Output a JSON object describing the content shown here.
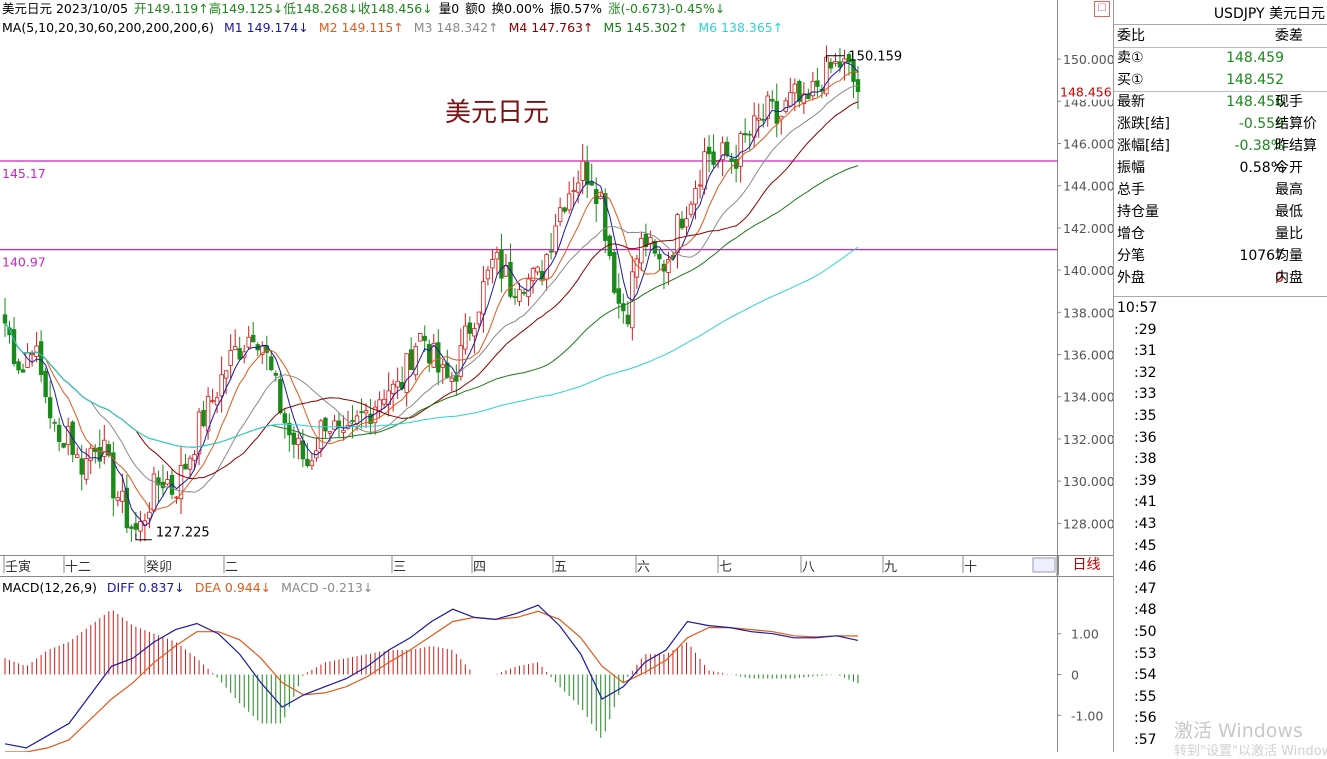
{
  "header": {
    "title_line": "美元日元 2023/10/05",
    "open": "开149.119↑",
    "high": "高149.125↓",
    "low": "低148.268↓",
    "close": "收148.456↓",
    "volume": "量0",
    "amount": "额0",
    "turnover": "换0.00%",
    "amplitude": "振0.57%",
    "change": "涨(-0.673)-0.45%↓"
  },
  "ma_line": {
    "label": "MA(5,10,20,30,60,200,200,200,6)",
    "items": [
      {
        "text": "M1 149.174↓",
        "color": "#1a1aa0"
      },
      {
        "text": "M2 149.115↑",
        "color": "#e05a1a"
      },
      {
        "text": "M3 148.342↑",
        "color": "#8a8a8a"
      },
      {
        "text": "M4 147.763↑",
        "color": "#8b0000"
      },
      {
        "text": "M5 145.302↑",
        "color": "#1a7a1a"
      },
      {
        "text": "M6 138.365↑",
        "color": "#2ad4d4"
      }
    ]
  },
  "chart_label": "美元日元",
  "hlines": [
    {
      "label": "145.17",
      "value": 145.17
    },
    {
      "label": "140.97",
      "value": 140.97
    }
  ],
  "annotations": {
    "max": "150.159",
    "min": "127.225",
    "last_price": "148.456"
  },
  "months": [
    "壬寅",
    "十二",
    "癸卯",
    "二",
    "三",
    "四",
    "五",
    "六",
    "七",
    "八",
    "九",
    "十"
  ],
  "timeframe_button": "日线",
  "macd_header": {
    "label": "MACD(12,26,9)",
    "diff": "DIFF 0.837↓",
    "dea": "DEA 0.944↓",
    "macd": "MACD -0.213↓"
  },
  "sidebar": {
    "symbol": "USDJPY 美元日元",
    "rows": [
      {
        "l": "委比",
        "v": "",
        "r": "委差"
      },
      {
        "l": "卖①",
        "v": "148.459",
        "r": ""
      },
      {
        "l": "买①",
        "v": "148.452",
        "r": ""
      },
      {
        "l": "最新",
        "v": "148.456",
        "r": "现手"
      },
      {
        "l": "涨跌[结]",
        "v": "-0.559",
        "r": "结算价"
      },
      {
        "l": "涨幅[结]",
        "v": "-0.38%",
        "r": "昨结算"
      },
      {
        "l": "振幅",
        "v": "0.58%",
        "r": "今开"
      },
      {
        "l": "总手",
        "v": "",
        "r": "最高"
      },
      {
        "l": "持仓量",
        "v": "",
        "r": "最低"
      },
      {
        "l": "增仓",
        "v": "",
        "r": "量比"
      },
      {
        "l": "分笔",
        "v": "10767",
        "r": "均量"
      },
      {
        "l": "外盘",
        "v": "0",
        "r": "内盘"
      }
    ],
    "times": [
      "10:57",
      ":29",
      ":31",
      ":32",
      ":33",
      ":35",
      ":36",
      ":38",
      ":39",
      ":41",
      ":43",
      ":45",
      ":46",
      ":47",
      ":48",
      ":50",
      ":53",
      ":54",
      ":55",
      ":56",
      ":57"
    ]
  },
  "watermark": {
    "line1": "激活 Windows",
    "line2": "转到\"设置\"以激活 Windows。"
  },
  "chart_data": [
    {
      "type": "candlestick",
      "title": "美元日元",
      "timeframe": "日线",
      "ylim": [
        126.5,
        151.0
      ],
      "y_ticks": [
        128.0,
        130.0,
        132.0,
        134.0,
        136.0,
        138.0,
        140.0,
        142.0,
        144.0,
        146.0,
        148.0,
        150.0
      ],
      "y_tick_labels": [
        "128.000",
        "130.000",
        "132.000",
        "134.000",
        "136.000",
        "138.000",
        "140.000",
        "142.000",
        "144.000",
        "146.000",
        "148.000",
        "150.000"
      ],
      "x_labels": [
        "壬寅",
        "十二",
        "癸卯",
        "二",
        "三",
        "四",
        "五",
        "六",
        "七",
        "八",
        "九",
        "十"
      ],
      "close_path": [
        137.5,
        136.2,
        135.2,
        136.8,
        135.0,
        133.5,
        131.5,
        132.8,
        131.0,
        130.8,
        132.0,
        131.5,
        130.0,
        129.0,
        128.0,
        127.5,
        128.8,
        129.8,
        130.2,
        129.5,
        130.5,
        131.5,
        132.8,
        133.5,
        134.5,
        135.5,
        136.2,
        136.6,
        137.3,
        136.5,
        135.0,
        133.5,
        132.2,
        131.5,
        130.8,
        131.8,
        133.0,
        132.5,
        131.6,
        132.2,
        133.0,
        133.4,
        134.0,
        134.5,
        134.2,
        135.0,
        136.5,
        137.0,
        136.0,
        135.0,
        134.7,
        135.5,
        137.0,
        138.2,
        139.3,
        140.4,
        140.0,
        139.2,
        139.8,
        139.5,
        139.6,
        140.8,
        142.5,
        143.5,
        144.2,
        144.7,
        144.6,
        143.4,
        141.0,
        138.5,
        138.0,
        140.5,
        141.5,
        140.5,
        140.2,
        141.0,
        142.5,
        143.4,
        144.5,
        145.8,
        145.0,
        145.5,
        145.2,
        146.0,
        146.5,
        147.0,
        147.6,
        147.0,
        147.8,
        148.2,
        147.5,
        148.5,
        149.2,
        149.5,
        149.8,
        149.4,
        148.456
      ],
      "series": [
        {
          "name": "M1",
          "color": "#1a1aa0"
        },
        {
          "name": "M2",
          "color": "#e05a1a"
        },
        {
          "name": "M3",
          "color": "#8a8a8a"
        },
        {
          "name": "M4",
          "color": "#8b0000"
        },
        {
          "name": "M5",
          "color": "#1a7a1a"
        },
        {
          "name": "M6",
          "color": "#2ad4d4"
        }
      ],
      "hlines": [
        145.17,
        140.97
      ],
      "max_value": 150.159,
      "min_value": 127.225,
      "last_price": 148.456
    },
    {
      "type": "bar",
      "title": "MACD(12,26,9)",
      "ylim": [
        -1.9,
        1.9
      ],
      "y_ticks": [
        1.0,
        0,
        -1.0
      ],
      "y_tick_labels": [
        "1.00",
        "0",
        "-1.00"
      ],
      "diff_path": [
        -1.7,
        -1.8,
        -1.5,
        -1.2,
        -0.5,
        0.2,
        0.4,
        0.8,
        1.1,
        1.25,
        1.0,
        0.5,
        -0.2,
        -0.8,
        -0.5,
        -0.3,
        -0.1,
        0.2,
        0.6,
        0.9,
        1.3,
        1.6,
        1.4,
        1.35,
        1.5,
        1.7,
        1.2,
        0.5,
        -0.6,
        -0.3,
        0.3,
        0.6,
        1.3,
        1.2,
        1.15,
        1.05,
        1.0,
        0.9,
        0.9,
        0.95,
        0.837
      ],
      "dea_path": [
        -1.9,
        -1.9,
        -1.8,
        -1.6,
        -1.1,
        -0.6,
        -0.2,
        0.3,
        0.7,
        1.05,
        1.05,
        0.85,
        0.4,
        -0.2,
        -0.5,
        -0.45,
        -0.3,
        -0.05,
        0.3,
        0.6,
        0.95,
        1.3,
        1.4,
        1.35,
        1.4,
        1.55,
        1.35,
        0.9,
        0.2,
        -0.2,
        0.05,
        0.35,
        0.9,
        1.15,
        1.15,
        1.1,
        1.05,
        0.95,
        0.92,
        0.95,
        0.944
      ],
      "last_diff": 0.837,
      "last_dea": 0.944,
      "last_macd": -0.213
    }
  ]
}
